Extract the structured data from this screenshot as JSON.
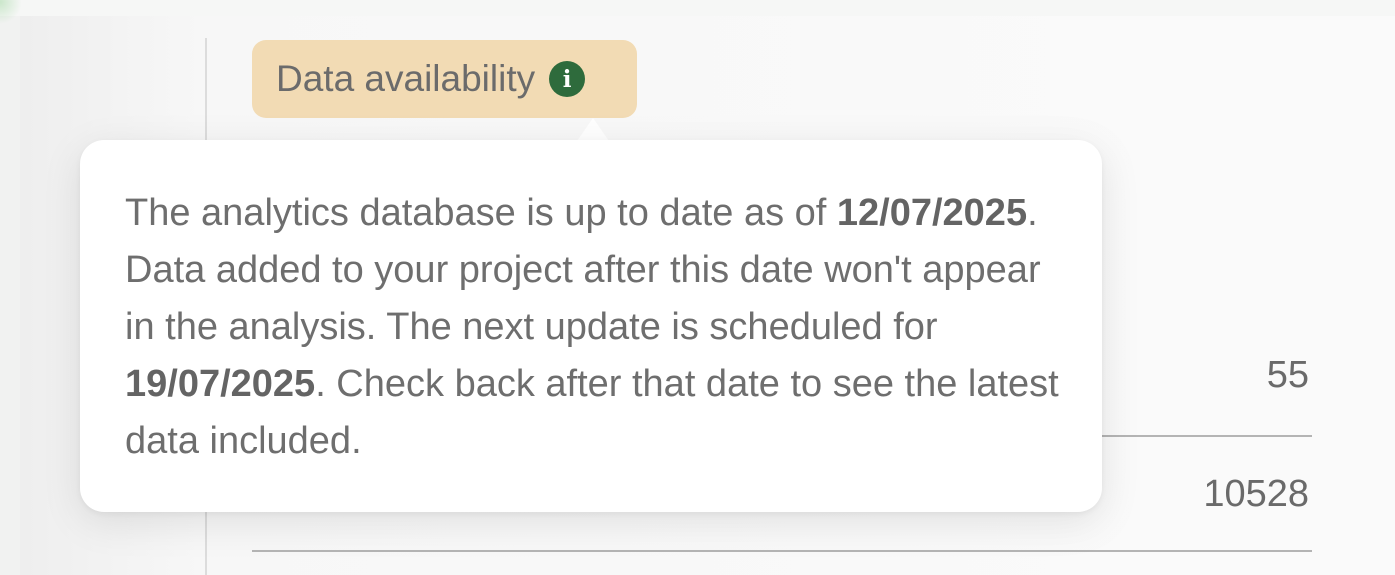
{
  "badge": {
    "label": "Data availability",
    "icon": "info-icon",
    "icon_glyph": "i",
    "background_color": "#f2dbb4",
    "icon_color": "#2e6b3c"
  },
  "tooltip": {
    "part1": "The analytics database is up to date as of ",
    "current_date": "12/07/2025",
    "part2": ". Data added to your project after this date won't appear in the analysis. The next update is scheduled for ",
    "next_update_date": "19/07/2025",
    "part3": ". Check back after that date to see the latest data included."
  },
  "stats": [
    {
      "value": "55"
    },
    {
      "value": "10528"
    }
  ]
}
